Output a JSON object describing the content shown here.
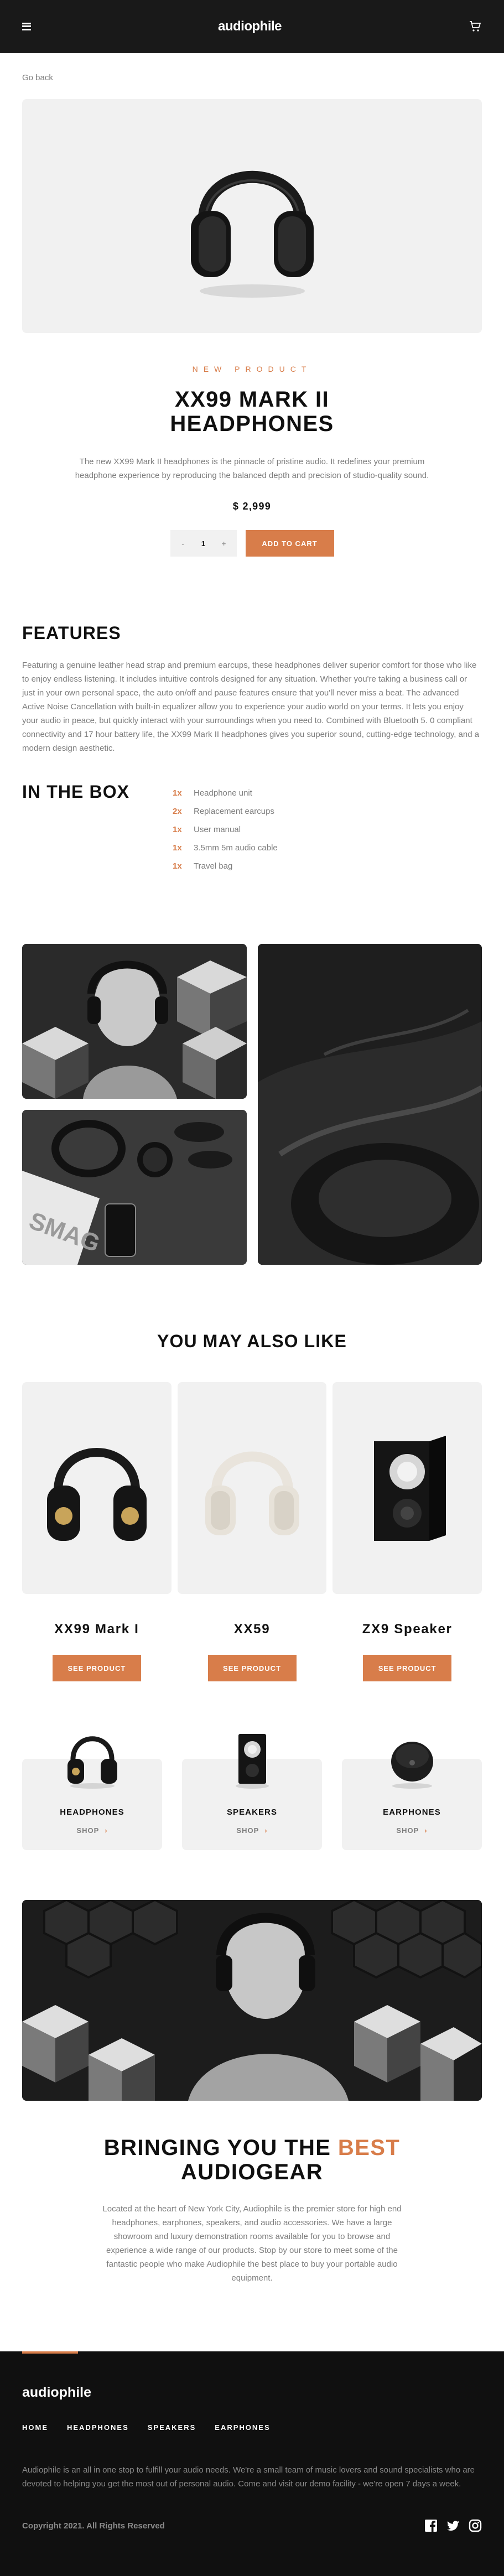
{
  "header": {
    "logo": "audiophile"
  },
  "nav": {
    "go_back": "Go back"
  },
  "product": {
    "overline": "NEW PRODUCT",
    "title": "XX99 MARK II HEADPHONES",
    "description": "The new XX99 Mark II headphones is the pinnacle of pristine audio. It redefines your premium headphone experience by reproducing the balanced depth and precision of studio-quality sound.",
    "price": "$ 2,999",
    "quantity": "1",
    "qty_minus": "-",
    "qty_plus": "+",
    "add_to_cart": "ADD TO CART"
  },
  "features": {
    "heading": "FEATURES",
    "text": "Featuring a genuine leather head strap and premium earcups, these headphones deliver superior comfort for those who like to enjoy endless listening. It includes intuitive controls designed for any situation. Whether you're taking a business call or just in your own personal space, the auto on/off and pause features ensure that you'll never miss a beat. The advanced Active Noise Cancellation with built-in equalizer allow you to experience your audio world on your terms. It lets you enjoy your audio in peace, but quickly interact with your surroundings when you need to. Combined with Bluetooth 5. 0 compliant connectivity and 17 hour battery life, the XX99 Mark II headphones gives you superior sound, cutting-edge technology, and a modern design aesthetic."
  },
  "in_the_box": {
    "heading": "IN THE BOX",
    "items": [
      {
        "qty": "1x",
        "name": "Headphone unit"
      },
      {
        "qty": "2x",
        "name": "Replacement earcups"
      },
      {
        "qty": "1x",
        "name": "User manual"
      },
      {
        "qty": "1x",
        "name": "3.5mm 5m audio cable"
      },
      {
        "qty": "1x",
        "name": "Travel bag"
      }
    ]
  },
  "also_like": {
    "heading": "YOU MAY ALSO LIKE",
    "items": [
      {
        "name": "XX99 Mark I",
        "button": "SEE PRODUCT"
      },
      {
        "name": "XX59",
        "button": "SEE PRODUCT"
      },
      {
        "name": "ZX9 Speaker",
        "button": "SEE PRODUCT"
      }
    ]
  },
  "categories": [
    {
      "name": "HEADPHONES",
      "shop": "SHOP"
    },
    {
      "name": "SPEAKERS",
      "shop": "SHOP"
    },
    {
      "name": "EARPHONES",
      "shop": "SHOP"
    }
  ],
  "about": {
    "heading_pre": "BRINGING YOU THE ",
    "heading_accent": "BEST",
    "heading_post": " AUDIOGEAR",
    "text": "Located at the heart of New York City, Audiophile is the premier store for high end headphones, earphones, speakers, and audio accessories. We have a large showroom and luxury demonstration rooms available for you to browse and experience a wide range of our products. Stop by our store to meet some of the fantastic people who make Audiophile the best place to buy your portable audio equipment."
  },
  "footer": {
    "logo": "audiophile",
    "nav": [
      "HOME",
      "HEADPHONES",
      "SPEAKERS",
      "EARPHONES"
    ],
    "description": "Audiophile is an all in one stop to fulfill your audio needs. We're a small team of music lovers and sound specialists who are devoted to helping you get the most out of personal audio. Come and visit our demo facility - we're open 7 days a week.",
    "copyright": "Copyright 2021. All Rights Reserved"
  },
  "icons": {
    "menu": "hamburger-icon",
    "cart": "cart-icon",
    "social": [
      "facebook-icon",
      "twitter-icon",
      "instagram-icon"
    ]
  },
  "colors": {
    "accent": "#d87d4a",
    "dark": "#191919",
    "light_bg": "#f1f1f1"
  }
}
